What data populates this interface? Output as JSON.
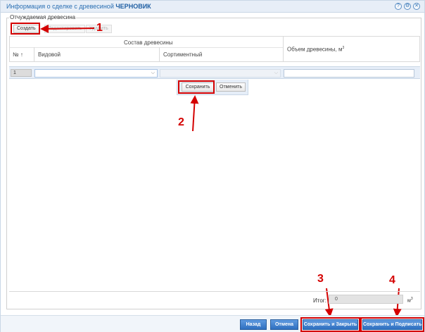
{
  "window": {
    "title_prefix": "Информация о сделке с древесиной",
    "title_status": "ЧЕРНОВИК",
    "icons": [
      "help-icon",
      "settings-icon",
      "close-icon"
    ],
    "icon_glyphs": {
      "help": "?",
      "settings": "⚙",
      "close": "✕"
    }
  },
  "section": {
    "legend": "Отчуждаемая древесина"
  },
  "toolbar": {
    "create_label": "Создать",
    "edit_label": "Редактировать",
    "delete_label": "Удалить"
  },
  "grid": {
    "group_header": "Состав древесины",
    "col_num": "№",
    "sort_glyph": "↑",
    "col_species": "Видовой",
    "col_assortment": "Сортиментный",
    "col_volume": "Объем древесины, м",
    "col_volume_sup": "3"
  },
  "edit_row": {
    "row_number": "1",
    "species_value": "",
    "assortment_value": "",
    "volume_value": "",
    "dropdown_glyph": "⌵"
  },
  "row_editor": {
    "save_label": "Сохранить",
    "cancel_label": "Отменить"
  },
  "totals": {
    "label": "Итог:",
    "value": "0",
    "unit": "м",
    "unit_sup": "3"
  },
  "footer": {
    "back_label": "Назад",
    "cancel_label": "Отмена",
    "save_close_label": "Сохранить и Закрыть",
    "save_sign_label": "Сохранить и Подписать"
  },
  "annotations": [
    "1",
    "2",
    "3",
    "4"
  ],
  "colors": {
    "accent": "#2f6fbf",
    "annotation": "#d40000",
    "title": "#2a6fb3"
  }
}
